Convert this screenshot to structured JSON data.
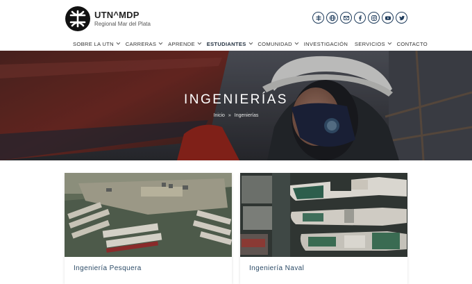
{
  "header": {
    "logo_title": "UTN^MDP",
    "logo_subtitle": "Regional Mar del Plata"
  },
  "social": [
    {
      "name": "utn-icon"
    },
    {
      "name": "globe-icon"
    },
    {
      "name": "mail-icon"
    },
    {
      "name": "facebook-icon"
    },
    {
      "name": "instagram-icon"
    },
    {
      "name": "youtube-icon"
    },
    {
      "name": "twitter-icon"
    }
  ],
  "nav": {
    "items": [
      {
        "label": "SOBRE LA UTN",
        "dropdown": true
      },
      {
        "label": "CARRERAS",
        "dropdown": true
      },
      {
        "label": "APRENDE",
        "dropdown": true
      },
      {
        "label": "ESTUDIANTES",
        "dropdown": true,
        "active": true
      },
      {
        "label": "COMUNIDAD",
        "dropdown": true
      },
      {
        "label": "INVESTIGACIÓN",
        "dropdown": false
      },
      {
        "label": "SERVICIOS",
        "dropdown": true
      },
      {
        "label": "CONTACTO",
        "dropdown": false
      }
    ]
  },
  "hero": {
    "title": "INGENIERÍAS",
    "breadcrumb": [
      "Inicio",
      "»",
      "Ingenierías"
    ]
  },
  "cards": [
    {
      "title": "Ingeniería Pesquera"
    },
    {
      "title": "Ingeniería Naval"
    }
  ],
  "colors": {
    "brand_dark": "#1f3c5c",
    "card_title": "#2b4a66"
  }
}
